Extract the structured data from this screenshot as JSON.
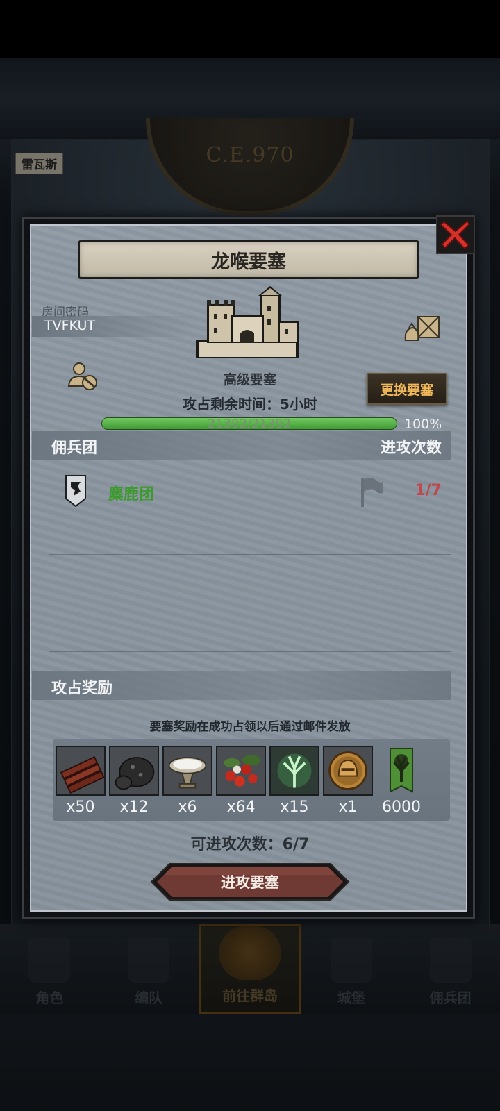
{
  "background": {
    "era_label": "C.E.970",
    "map_tag": "雷瓦斯",
    "nav": [
      {
        "label": "角色",
        "active": false
      },
      {
        "label": "编队",
        "active": false
      },
      {
        "label": "前往群岛",
        "active": true
      },
      {
        "label": "城堡",
        "active": false
      },
      {
        "label": "佣兵团",
        "active": false
      }
    ]
  },
  "dialog": {
    "title": "龙喉要塞",
    "room_code_label": "房间密码",
    "room_code": "TVFKUT",
    "fortress_type": "高级要塞",
    "change_button": "更换要塞",
    "remaining_time": "攻占剩余时间：5小时",
    "hp": {
      "current": 21392,
      "max": 21392,
      "text": "21392/21392",
      "percent_text": "100%",
      "fraction": 1.0
    },
    "mercenary_section": {
      "left": "佣兵团",
      "right": "进攻次数"
    },
    "teams": [
      {
        "name": "麋鹿团",
        "attacks": "1/7"
      }
    ],
    "reward_section_title": "攻占奖励",
    "reward_note": "要塞奖励在成功占领以后通过邮件发放",
    "rewards": [
      {
        "icon": "wood-planks-icon",
        "qty": "x50"
      },
      {
        "icon": "ore-rock-icon",
        "qty": "x12"
      },
      {
        "icon": "salt-bowl-icon",
        "qty": "x6"
      },
      {
        "icon": "berries-icon",
        "qty": "x64"
      },
      {
        "icon": "spirit-tree-icon",
        "qty": "x15"
      },
      {
        "icon": "helmet-coin-icon",
        "qty": "x1"
      },
      {
        "icon": "tree-banner-icon",
        "qty": "6000"
      }
    ],
    "available_attacks": "可进攻次数：6/7",
    "attack_button": "进攻要塞"
  },
  "colors": {
    "team_name": "#3c9a2e",
    "attack_count": "#c0474c",
    "change_button_text": "#f0b85a",
    "hp_fill": "#4fae3f"
  }
}
